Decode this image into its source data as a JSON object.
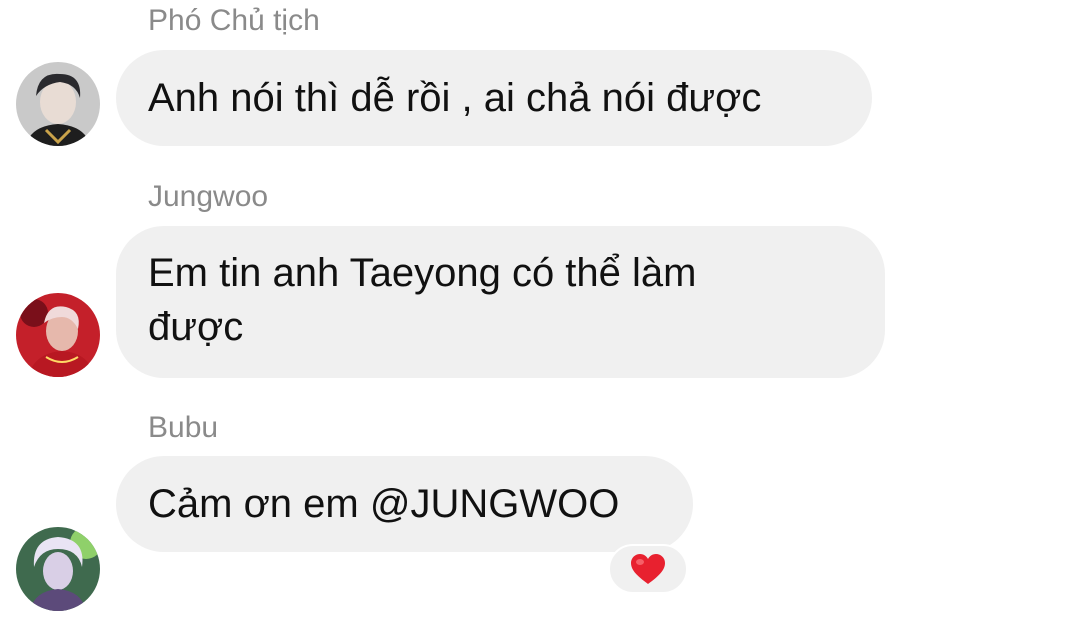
{
  "messages": [
    {
      "sender": "Phó Chủ tịch",
      "text": "Anh nói thì dễ rồi , ai chả nói được",
      "avatar_icon": "user-avatar-1"
    },
    {
      "sender": "Jungwoo",
      "text_line1": "Em tin anh Taeyong có thể làm",
      "text_line2": "được",
      "avatar_icon": "user-avatar-2"
    },
    {
      "sender": "Bubu",
      "text": "Cảm ơn em @JUNGWOO",
      "avatar_icon": "user-avatar-3",
      "reaction": "heart-reaction",
      "reaction_color": "#e8212f"
    }
  ],
  "colors": {
    "bubble_bg": "#f0f0f0",
    "sender_name": "#8a8a8a",
    "message_text": "#111111"
  }
}
